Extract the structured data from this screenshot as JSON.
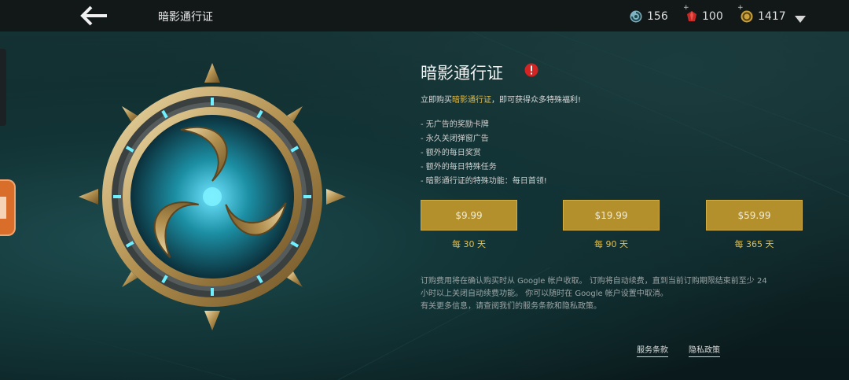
{
  "topbar": {
    "title": "暗影通行证",
    "currencies": [
      {
        "icon": "spiral-token-icon",
        "value": "156"
      },
      {
        "icon": "red-gem-icon",
        "value": "100"
      },
      {
        "icon": "gold-coin-icon",
        "value": "1417"
      }
    ]
  },
  "pass": {
    "title": "暗影通行证",
    "intro_prefix": "立即购买",
    "intro_highlight": "暗影通行证",
    "intro_suffix": "，即可获得众多特殊福利!",
    "benefits": [
      "- 无广告的奖励卡牌",
      "- 永久关闭弹窗广告",
      "- 额外的每日奖赏",
      "- 额外的每日特殊任务",
      "- 暗影通行证的特殊功能：每日首领!"
    ]
  },
  "plans": [
    {
      "price": "$9.99",
      "period": "每 30 天"
    },
    {
      "price": "$19.99",
      "period": "每 90 天"
    },
    {
      "price": "$59.99",
      "period": "每 365 天"
    }
  ],
  "terms": {
    "line1": "订购费用将在确认购买时从 Google 帐户收取。 订购将自动续费，直到当前订购期限结束前至少 24",
    "line2": "小时以上关闭自动续费功能。 你可以随时在 Google 帐户设置中取消。",
    "line3": "有关更多信息，请查阅我们的服务条款和隐私政策。"
  },
  "links": {
    "terms_of_service": "服务条款",
    "privacy_policy": "隐私政策"
  },
  "colors": {
    "accent_gold": "#b3902b",
    "highlight_text": "#e9b93a",
    "alert_red": "#d32424"
  }
}
